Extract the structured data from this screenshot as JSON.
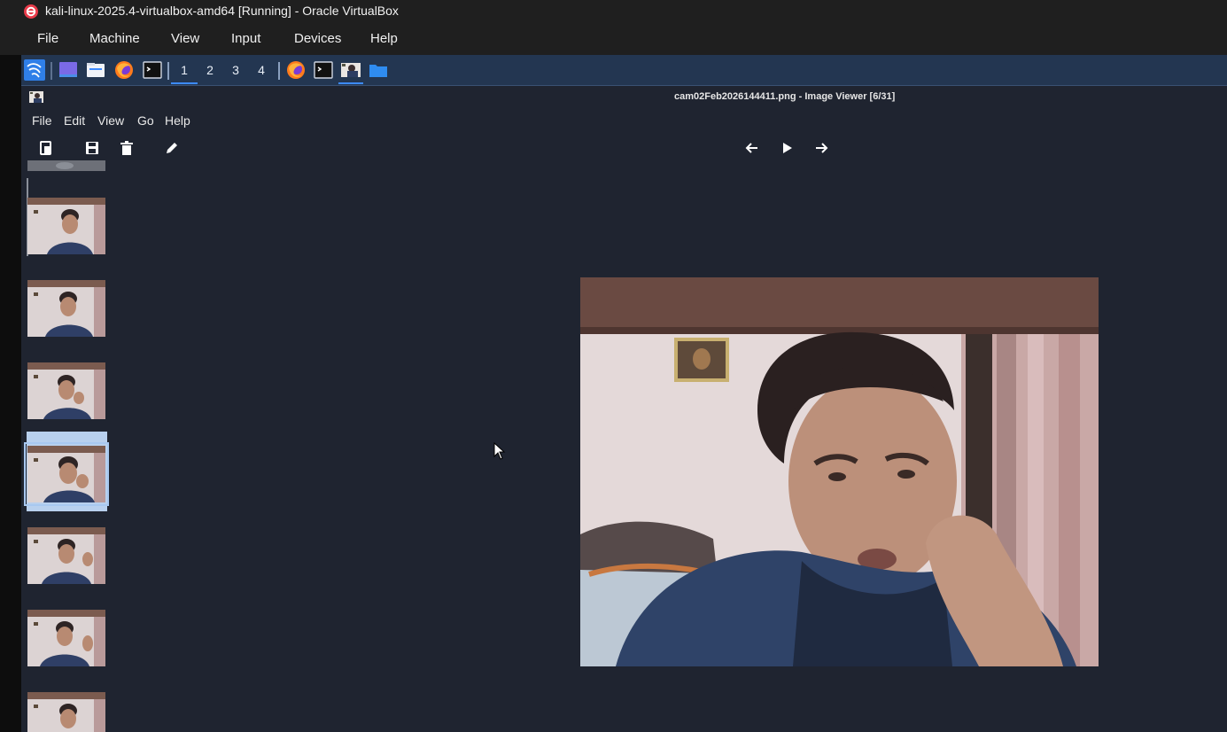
{
  "virtualbox": {
    "title": "kali-linux-2025.4-virtualbox-amd64 [Running] - Oracle VirtualBox",
    "menu": [
      "File",
      "Machine",
      "View",
      "Input",
      "Devices",
      "Help"
    ],
    "logo_icon": "virtualbox-logo-icon"
  },
  "kali_panel": {
    "launchers": [
      "kali-menu-icon",
      "desktop-icon",
      "file-manager-icon",
      "firefox-icon",
      "terminal-icon"
    ],
    "workspaces": [
      "1",
      "2",
      "3",
      "4"
    ],
    "active_workspace": "1",
    "tasks": [
      "firefox-task-icon",
      "terminal-task-icon",
      "image-viewer-task-icon",
      "folder-task-icon"
    ],
    "accent_color": "#3d8bff",
    "background_color": "#233651"
  },
  "viewer": {
    "title": "cam02Feb2026144411.png - Image Viewer [6/31]",
    "menu": [
      "File",
      "Edit",
      "View",
      "Go",
      "Help"
    ],
    "toolbar_left": [
      "open-icon",
      "save-icon",
      "delete-icon",
      "edit-icon"
    ],
    "toolbar_nav": [
      "back-arrow-icon",
      "play-icon",
      "forward-arrow-icon"
    ],
    "background_color": "#1f2430",
    "selected_thumbnail_index": 4
  }
}
